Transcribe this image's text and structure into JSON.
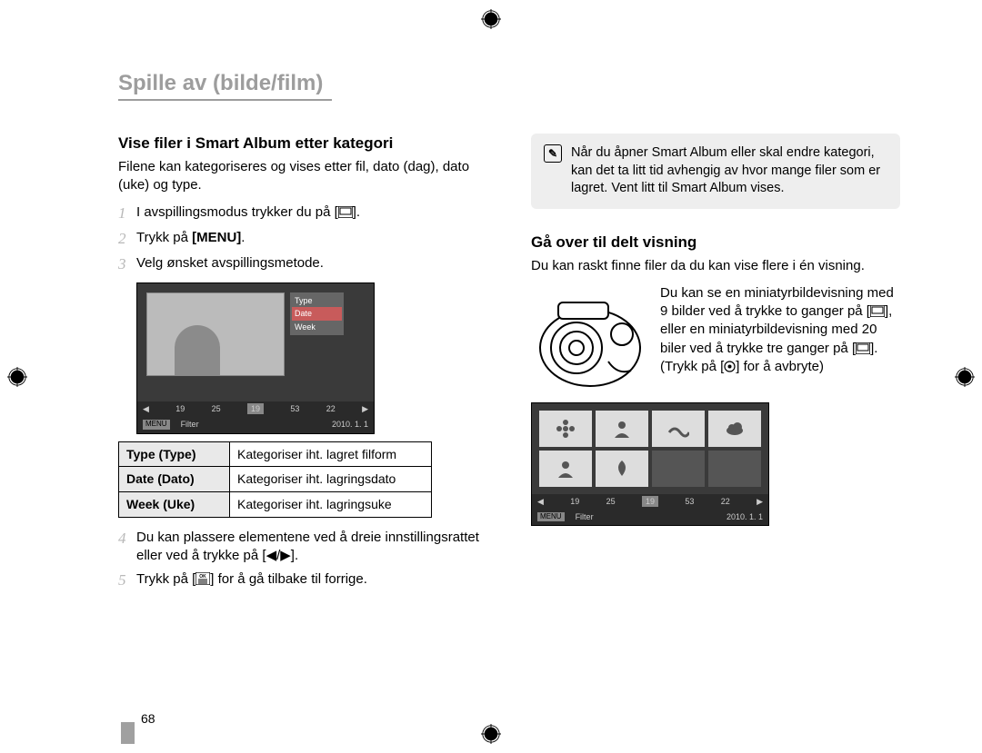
{
  "chapter_title": "Spille av (bilde/film)",
  "left": {
    "section_title": "Vise filer i Smart Album etter kategori",
    "intro": "Filene kan kategoriseres og vises etter fil, dato (dag), dato (uke) og type.",
    "steps": {
      "s1_a": "I avspillingsmodus trykker du på [",
      "s1_b": "].",
      "s2_a": "Trykk på ",
      "s2_menu": "[MENU]",
      "s2_b": ".",
      "s3": "Velg ønsket avspillingsmetode.",
      "s4": "Du kan plassere elementene ved å dreie innstillingsrattet eller ved å trykke på [◀/▶].",
      "s5_a": "Trykk på [",
      "s5_b": "] for å gå tilbake til forrige."
    },
    "screen1": {
      "menu_items": [
        "Type",
        "Date",
        "Week"
      ],
      "bar_values": [
        "19",
        "25",
        "19",
        "53",
        "22"
      ],
      "bar2_menu": "MENU",
      "bar2_filter": "Filter",
      "bar2_date": "2010. 1. 1"
    },
    "table": {
      "rows": [
        {
          "k": "Type (Type)",
          "v": "Kategoriser iht. lagret filform"
        },
        {
          "k": "Date (Dato)",
          "v": "Kategoriser iht. lagringsdato"
        },
        {
          "k": "Week (Uke)",
          "v": "Kategoriser iht. lagringsuke"
        }
      ]
    }
  },
  "right": {
    "note": "Når du åpner Smart Album eller skal endre kategori, kan det ta litt tid avhengig av hvor mange filer som er lagret. Vent litt til Smart Album vises.",
    "section_title": "Gå over til delt visning",
    "intro": "Du kan raskt finne filer da du kan vise flere i én visning.",
    "para_a": "Du kan se en miniatyrbildevisning med 9 bilder ved å trykke to ganger på [",
    "para_b": "], eller en miniatyrbildevisning med 20 biler ved å trykke tre ganger på [",
    "para_c": "]. (Trykk på [",
    "para_d": "] for å avbryte)",
    "screen2": {
      "bar_values": [
        "19",
        "25",
        "19",
        "53",
        "22"
      ],
      "bar2_menu": "MENU",
      "bar2_filter": "Filter",
      "bar2_date": "2010. 1. 1"
    }
  },
  "page_number": "68"
}
